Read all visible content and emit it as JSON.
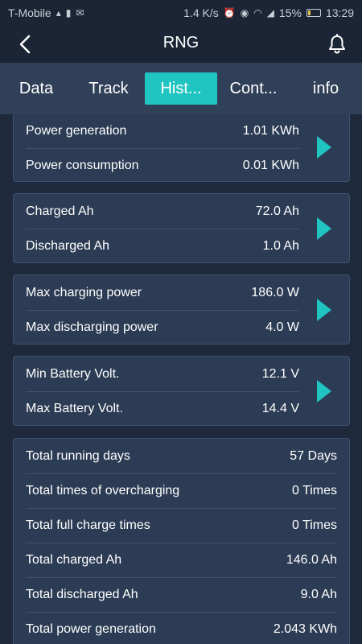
{
  "status_bar": {
    "carrier": "T-Mobile",
    "speed": "1.4 K/s",
    "battery": "15%",
    "time": "13:29"
  },
  "header": {
    "title": "RNG"
  },
  "tabs": [
    {
      "label": "Data"
    },
    {
      "label": "Track"
    },
    {
      "label": "Hist..."
    },
    {
      "label": "Cont..."
    },
    {
      "label": "info"
    }
  ],
  "cards": [
    {
      "rows": [
        {
          "label": "Power generation",
          "value": "1.01 KWh"
        },
        {
          "label": "Power consumption",
          "value": "0.01 KWh"
        }
      ]
    },
    {
      "rows": [
        {
          "label": "Charged Ah",
          "value": "72.0 Ah"
        },
        {
          "label": "Discharged Ah",
          "value": "1.0 Ah"
        }
      ]
    },
    {
      "rows": [
        {
          "label": "Max charging power",
          "value": "186.0 W"
        },
        {
          "label": "Max discharging power",
          "value": "4.0 W"
        }
      ]
    },
    {
      "rows": [
        {
          "label": "Min Battery Volt.",
          "value": "12.1 V"
        },
        {
          "label": "Max Battery Volt.",
          "value": "14.4 V"
        }
      ]
    }
  ],
  "totals": [
    {
      "label": "Total running days",
      "value": "57 Days"
    },
    {
      "label": "Total times of overcharging",
      "value": "0 Times"
    },
    {
      "label": "Total full charge times",
      "value": "0 Times"
    },
    {
      "label": "Total charged Ah",
      "value": "146.0 Ah"
    },
    {
      "label": "Total discharged Ah",
      "value": "9.0 Ah"
    },
    {
      "label": "Total power generation",
      "value": "2.043 KWh"
    }
  ],
  "colors": {
    "background": "#1e2a3b",
    "card": "#2c3c54",
    "accent": "#20c4c0",
    "tab_bar": "#304058"
  },
  "icons": {
    "back": "back-arrow-icon",
    "notifications": "bell-icon",
    "row_arrow": "chevron-right-icon"
  }
}
